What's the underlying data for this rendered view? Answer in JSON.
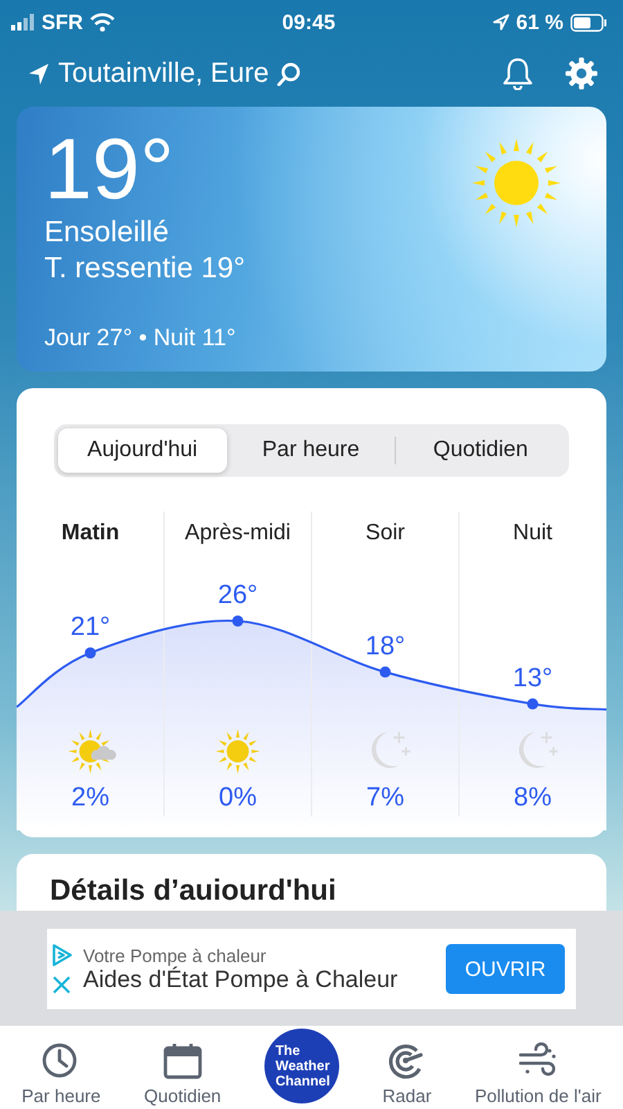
{
  "status_bar": {
    "carrier": "SFR",
    "time": "09:45",
    "battery": "61 %"
  },
  "header": {
    "location": "Toutainville, Eure"
  },
  "current": {
    "temperature": "19°",
    "condition": "Ensoleillé",
    "feels_like": "T. ressentie 19°",
    "day_night": "Jour 27° • Nuit 11°"
  },
  "forecast_tabs": [
    {
      "label": "Aujourd'hui",
      "selected": true
    },
    {
      "label": "Par heure",
      "selected": false
    },
    {
      "label": "Quotidien",
      "selected": false
    }
  ],
  "periods": [
    {
      "label": "Matin",
      "selected": true,
      "temp": "21°",
      "kind": "sun-cloud",
      "precip": "2%"
    },
    {
      "label": "Après-midi",
      "selected": false,
      "temp": "26°",
      "kind": "sun",
      "precip": "0%"
    },
    {
      "label": "Soir",
      "selected": false,
      "temp": "18°",
      "kind": "moon",
      "precip": "7%"
    },
    {
      "label": "Nuit",
      "selected": false,
      "temp": "13°",
      "kind": "moon",
      "precip": "8%"
    }
  ],
  "details": {
    "title": "Détails d’auiourd'hui"
  },
  "ad": {
    "subtitle": "Votre Pompe à chaleur",
    "title": "Aides d'État Pompe à Chaleur",
    "button": "OUVRIR"
  },
  "tab_bar": [
    {
      "kind": "clock",
      "label": "Par heure"
    },
    {
      "kind": "calendar",
      "label": "Quotidien"
    },
    {
      "kind": "logo",
      "label": "The Weather Channel"
    },
    {
      "kind": "radar",
      "label": "Radar"
    },
    {
      "kind": "wind",
      "label": "Pollution de l'air"
    }
  ]
}
